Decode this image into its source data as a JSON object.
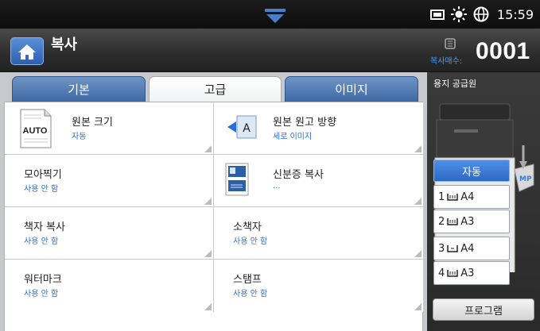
{
  "status": {
    "clock": "15:59",
    "icons": [
      "pulldown-arrow-icon",
      "tray-status-icon",
      "eco-sun-icon",
      "network-globe-icon"
    ]
  },
  "header": {
    "title": "복사",
    "count_label": "복사매수:",
    "count_value": "0001"
  },
  "tabs": [
    {
      "label": "기본"
    },
    {
      "label": "고급",
      "active": true
    },
    {
      "label": "이미지"
    }
  ],
  "options": [
    {
      "label": "원본 크기",
      "value": "자동",
      "icon": "auto-size-icon"
    },
    {
      "label": "원본 원고 방향",
      "value": "세로 이미지",
      "icon": "orientation-icon"
    },
    {
      "label": "모아찍기",
      "value": "사용 안 함"
    },
    {
      "label": "신분증 복사",
      "value": "...",
      "icon": "id-card-icon"
    },
    {
      "label": "책자 복사",
      "value": "사용 안 함"
    },
    {
      "label": "소책자",
      "value": "사용 안 함"
    },
    {
      "label": "워터마크",
      "value": "사용 안 함"
    },
    {
      "label": "스탬프",
      "value": "사용 안 함"
    }
  ],
  "paper": {
    "title": "용지 공급원",
    "auto_label": "자동",
    "mp_label": "MP",
    "trays": [
      {
        "num": "1",
        "size": "A4"
      },
      {
        "num": "2",
        "size": "A3"
      },
      {
        "num": "3",
        "size": "A4"
      },
      {
        "num": "4",
        "size": "A3"
      }
    ]
  },
  "program_button": "프로그램",
  "auto_icon_text": "AUTO",
  "orientation_icon_text": "A",
  "colors": {
    "accent": "#2a6fd1",
    "tab": "#4a74ad",
    "selected": "#3b7bd8"
  }
}
